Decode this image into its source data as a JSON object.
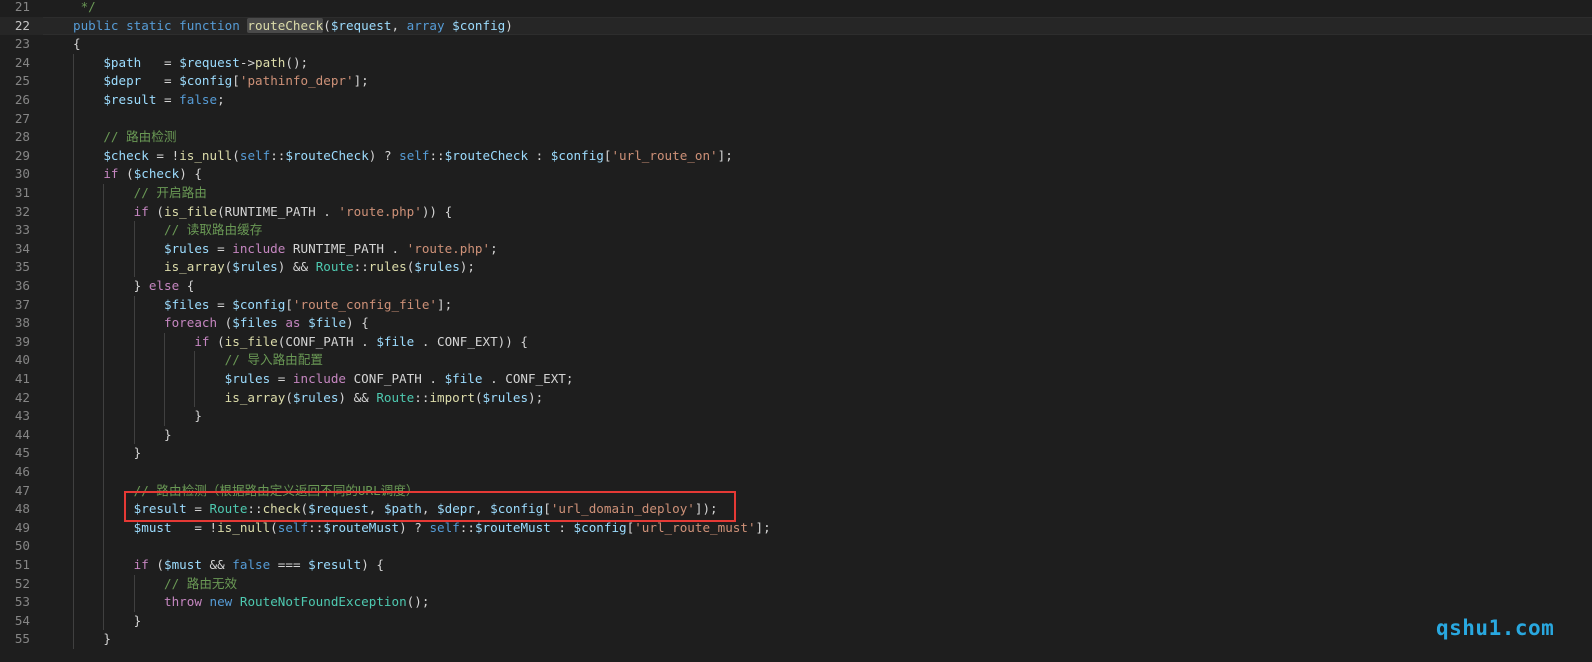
{
  "editor": {
    "language": "PHP",
    "function_name": "routeCheck",
    "current_line": "22",
    "highlighted_line": "48",
    "theme_colors": {
      "background": "#1e1e1e",
      "keyword": "#569cd6",
      "control": "#c586c0",
      "function": "#dcdcaa",
      "variable": "#9cdcfe",
      "string": "#ce9178",
      "comment": "#6a9955",
      "class": "#4ec9b0",
      "highlight_box": "#e53935"
    },
    "lines": [
      {
        "num": "21",
        "tokens": [
          {
            "t": " */",
            "c": "cmt"
          }
        ]
      },
      {
        "num": "22",
        "tokens": [
          {
            "t": "public static function ",
            "c": "kw"
          },
          {
            "t": "routeCheck",
            "c": "fn wordhl"
          },
          {
            "t": "(",
            "c": "plain"
          },
          {
            "t": "$request",
            "c": "var"
          },
          {
            "t": ", ",
            "c": "plain"
          },
          {
            "t": "array ",
            "c": "kw"
          },
          {
            "t": "$config",
            "c": "var"
          },
          {
            "t": ")",
            "c": "plain"
          }
        ]
      },
      {
        "num": "23",
        "tokens": [
          {
            "t": "{",
            "c": "plain"
          }
        ]
      },
      {
        "num": "24",
        "tokens": [
          {
            "t": "    ",
            "c": "plain"
          },
          {
            "t": "$path",
            "c": "var"
          },
          {
            "t": "   = ",
            "c": "plain"
          },
          {
            "t": "$request",
            "c": "var"
          },
          {
            "t": "->",
            "c": "plain"
          },
          {
            "t": "path",
            "c": "fn"
          },
          {
            "t": "();",
            "c": "plain"
          }
        ]
      },
      {
        "num": "25",
        "tokens": [
          {
            "t": "    ",
            "c": "plain"
          },
          {
            "t": "$depr",
            "c": "var"
          },
          {
            "t": "   = ",
            "c": "plain"
          },
          {
            "t": "$config",
            "c": "var"
          },
          {
            "t": "[",
            "c": "plain"
          },
          {
            "t": "'pathinfo_depr'",
            "c": "str"
          },
          {
            "t": "];",
            "c": "plain"
          }
        ]
      },
      {
        "num": "26",
        "tokens": [
          {
            "t": "    ",
            "c": "plain"
          },
          {
            "t": "$result",
            "c": "var"
          },
          {
            "t": " = ",
            "c": "plain"
          },
          {
            "t": "false",
            "c": "kw"
          },
          {
            "t": ";",
            "c": "plain"
          }
        ]
      },
      {
        "num": "27",
        "tokens": []
      },
      {
        "num": "28",
        "tokens": [
          {
            "t": "    ",
            "c": "plain"
          },
          {
            "t": "// 路由检测",
            "c": "cmt"
          }
        ]
      },
      {
        "num": "29",
        "tokens": [
          {
            "t": "    ",
            "c": "plain"
          },
          {
            "t": "$check",
            "c": "var"
          },
          {
            "t": " = !",
            "c": "plain"
          },
          {
            "t": "is_null",
            "c": "fn"
          },
          {
            "t": "(",
            "c": "plain"
          },
          {
            "t": "self",
            "c": "kw"
          },
          {
            "t": "::",
            "c": "plain"
          },
          {
            "t": "$routeCheck",
            "c": "var"
          },
          {
            "t": ") ? ",
            "c": "plain"
          },
          {
            "t": "self",
            "c": "kw"
          },
          {
            "t": "::",
            "c": "plain"
          },
          {
            "t": "$routeCheck",
            "c": "var"
          },
          {
            "t": " : ",
            "c": "plain"
          },
          {
            "t": "$config",
            "c": "var"
          },
          {
            "t": "[",
            "c": "plain"
          },
          {
            "t": "'url_route_on'",
            "c": "str"
          },
          {
            "t": "];",
            "c": "plain"
          }
        ]
      },
      {
        "num": "30",
        "tokens": [
          {
            "t": "    ",
            "c": "plain"
          },
          {
            "t": "if",
            "c": "ctl"
          },
          {
            "t": " (",
            "c": "plain"
          },
          {
            "t": "$check",
            "c": "var"
          },
          {
            "t": ") {",
            "c": "plain"
          }
        ]
      },
      {
        "num": "31",
        "tokens": [
          {
            "t": "        ",
            "c": "plain"
          },
          {
            "t": "// 开启路由",
            "c": "cmt"
          }
        ]
      },
      {
        "num": "32",
        "tokens": [
          {
            "t": "        ",
            "c": "plain"
          },
          {
            "t": "if",
            "c": "ctl"
          },
          {
            "t": " (",
            "c": "plain"
          },
          {
            "t": "is_file",
            "c": "fn"
          },
          {
            "t": "(RUNTIME_PATH . ",
            "c": "plain"
          },
          {
            "t": "'route.php'",
            "c": "str"
          },
          {
            "t": ")) {",
            "c": "plain"
          }
        ]
      },
      {
        "num": "33",
        "tokens": [
          {
            "t": "            ",
            "c": "plain"
          },
          {
            "t": "// 读取路由缓存",
            "c": "cmt"
          }
        ]
      },
      {
        "num": "34",
        "tokens": [
          {
            "t": "            ",
            "c": "plain"
          },
          {
            "t": "$rules",
            "c": "var"
          },
          {
            "t": " = ",
            "c": "plain"
          },
          {
            "t": "include",
            "c": "ctl"
          },
          {
            "t": " RUNTIME_PATH . ",
            "c": "plain"
          },
          {
            "t": "'route.php'",
            "c": "str"
          },
          {
            "t": ";",
            "c": "plain"
          }
        ]
      },
      {
        "num": "35",
        "tokens": [
          {
            "t": "            ",
            "c": "plain"
          },
          {
            "t": "is_array",
            "c": "fn"
          },
          {
            "t": "(",
            "c": "plain"
          },
          {
            "t": "$rules",
            "c": "var"
          },
          {
            "t": ") && ",
            "c": "plain"
          },
          {
            "t": "Route",
            "c": "cls"
          },
          {
            "t": "::",
            "c": "plain"
          },
          {
            "t": "rules",
            "c": "fn"
          },
          {
            "t": "(",
            "c": "plain"
          },
          {
            "t": "$rules",
            "c": "var"
          },
          {
            "t": ");",
            "c": "plain"
          }
        ]
      },
      {
        "num": "36",
        "tokens": [
          {
            "t": "        } ",
            "c": "plain"
          },
          {
            "t": "else",
            "c": "ctl"
          },
          {
            "t": " {",
            "c": "plain"
          }
        ]
      },
      {
        "num": "37",
        "tokens": [
          {
            "t": "            ",
            "c": "plain"
          },
          {
            "t": "$files",
            "c": "var"
          },
          {
            "t": " = ",
            "c": "plain"
          },
          {
            "t": "$config",
            "c": "var"
          },
          {
            "t": "[",
            "c": "plain"
          },
          {
            "t": "'route_config_file'",
            "c": "str"
          },
          {
            "t": "];",
            "c": "plain"
          }
        ]
      },
      {
        "num": "38",
        "tokens": [
          {
            "t": "            ",
            "c": "plain"
          },
          {
            "t": "foreach",
            "c": "ctl"
          },
          {
            "t": " (",
            "c": "plain"
          },
          {
            "t": "$files",
            "c": "var"
          },
          {
            "t": " ",
            "c": "plain"
          },
          {
            "t": "as",
            "c": "ctl"
          },
          {
            "t": " ",
            "c": "plain"
          },
          {
            "t": "$file",
            "c": "var"
          },
          {
            "t": ") {",
            "c": "plain"
          }
        ]
      },
      {
        "num": "39",
        "tokens": [
          {
            "t": "                ",
            "c": "plain"
          },
          {
            "t": "if",
            "c": "ctl"
          },
          {
            "t": " (",
            "c": "plain"
          },
          {
            "t": "is_file",
            "c": "fn"
          },
          {
            "t": "(CONF_PATH . ",
            "c": "plain"
          },
          {
            "t": "$file",
            "c": "var"
          },
          {
            "t": " . CONF_EXT)) {",
            "c": "plain"
          }
        ]
      },
      {
        "num": "40",
        "tokens": [
          {
            "t": "                    ",
            "c": "plain"
          },
          {
            "t": "// 导入路由配置",
            "c": "cmt"
          }
        ]
      },
      {
        "num": "41",
        "tokens": [
          {
            "t": "                    ",
            "c": "plain"
          },
          {
            "t": "$rules",
            "c": "var"
          },
          {
            "t": " = ",
            "c": "plain"
          },
          {
            "t": "include",
            "c": "ctl"
          },
          {
            "t": " CONF_PATH . ",
            "c": "plain"
          },
          {
            "t": "$file",
            "c": "var"
          },
          {
            "t": " . CONF_EXT;",
            "c": "plain"
          }
        ]
      },
      {
        "num": "42",
        "tokens": [
          {
            "t": "                    ",
            "c": "plain"
          },
          {
            "t": "is_array",
            "c": "fn"
          },
          {
            "t": "(",
            "c": "plain"
          },
          {
            "t": "$rules",
            "c": "var"
          },
          {
            "t": ") && ",
            "c": "plain"
          },
          {
            "t": "Route",
            "c": "cls"
          },
          {
            "t": "::",
            "c": "plain"
          },
          {
            "t": "import",
            "c": "fn"
          },
          {
            "t": "(",
            "c": "plain"
          },
          {
            "t": "$rules",
            "c": "var"
          },
          {
            "t": ");",
            "c": "plain"
          }
        ]
      },
      {
        "num": "43",
        "tokens": [
          {
            "t": "                }",
            "c": "plain"
          }
        ]
      },
      {
        "num": "44",
        "tokens": [
          {
            "t": "            }",
            "c": "plain"
          }
        ]
      },
      {
        "num": "45",
        "tokens": [
          {
            "t": "        }",
            "c": "plain"
          }
        ]
      },
      {
        "num": "46",
        "tokens": []
      },
      {
        "num": "47",
        "tokens": [
          {
            "t": "        ",
            "c": "plain"
          },
          {
            "t": "// 路由检测（根据路由定义返回不同的URL调度）",
            "c": "cmt"
          }
        ]
      },
      {
        "num": "48",
        "tokens": [
          {
            "t": "        ",
            "c": "plain"
          },
          {
            "t": "$result",
            "c": "var"
          },
          {
            "t": " = ",
            "c": "plain"
          },
          {
            "t": "Route",
            "c": "cls"
          },
          {
            "t": "::",
            "c": "plain"
          },
          {
            "t": "check",
            "c": "fn"
          },
          {
            "t": "(",
            "c": "plain"
          },
          {
            "t": "$request",
            "c": "var"
          },
          {
            "t": ", ",
            "c": "plain"
          },
          {
            "t": "$path",
            "c": "var"
          },
          {
            "t": ", ",
            "c": "plain"
          },
          {
            "t": "$depr",
            "c": "var"
          },
          {
            "t": ", ",
            "c": "plain"
          },
          {
            "t": "$config",
            "c": "var"
          },
          {
            "t": "[",
            "c": "plain"
          },
          {
            "t": "'url_domain_deploy'",
            "c": "str"
          },
          {
            "t": "]);",
            "c": "plain"
          }
        ]
      },
      {
        "num": "49",
        "tokens": [
          {
            "t": "        ",
            "c": "plain"
          },
          {
            "t": "$must",
            "c": "var"
          },
          {
            "t": "   = !",
            "c": "plain"
          },
          {
            "t": "is_null",
            "c": "fn"
          },
          {
            "t": "(",
            "c": "plain"
          },
          {
            "t": "self",
            "c": "kw"
          },
          {
            "t": "::",
            "c": "plain"
          },
          {
            "t": "$routeMust",
            "c": "var"
          },
          {
            "t": ") ? ",
            "c": "plain"
          },
          {
            "t": "self",
            "c": "kw"
          },
          {
            "t": "::",
            "c": "plain"
          },
          {
            "t": "$routeMust",
            "c": "var"
          },
          {
            "t": " : ",
            "c": "plain"
          },
          {
            "t": "$config",
            "c": "var"
          },
          {
            "t": "[",
            "c": "plain"
          },
          {
            "t": "'url_route_must'",
            "c": "str"
          },
          {
            "t": "];",
            "c": "plain"
          }
        ]
      },
      {
        "num": "50",
        "tokens": []
      },
      {
        "num": "51",
        "tokens": [
          {
            "t": "        ",
            "c": "plain"
          },
          {
            "t": "if",
            "c": "ctl"
          },
          {
            "t": " (",
            "c": "plain"
          },
          {
            "t": "$must",
            "c": "var"
          },
          {
            "t": " && ",
            "c": "plain"
          },
          {
            "t": "false",
            "c": "kw"
          },
          {
            "t": " === ",
            "c": "plain"
          },
          {
            "t": "$result",
            "c": "var"
          },
          {
            "t": ") {",
            "c": "plain"
          }
        ]
      },
      {
        "num": "52",
        "tokens": [
          {
            "t": "            ",
            "c": "plain"
          },
          {
            "t": "// 路由无效",
            "c": "cmt"
          }
        ]
      },
      {
        "num": "53",
        "tokens": [
          {
            "t": "            ",
            "c": "plain"
          },
          {
            "t": "throw",
            "c": "ctl"
          },
          {
            "t": " ",
            "c": "plain"
          },
          {
            "t": "new",
            "c": "kw"
          },
          {
            "t": " ",
            "c": "plain"
          },
          {
            "t": "RouteNotFoundException",
            "c": "cls"
          },
          {
            "t": "();",
            "c": "plain"
          }
        ]
      },
      {
        "num": "54",
        "tokens": [
          {
            "t": "        }",
            "c": "plain"
          }
        ]
      },
      {
        "num": "55",
        "tokens": [
          {
            "t": "    }",
            "c": "plain"
          }
        ]
      }
    ]
  },
  "watermark": "qshu1.com"
}
